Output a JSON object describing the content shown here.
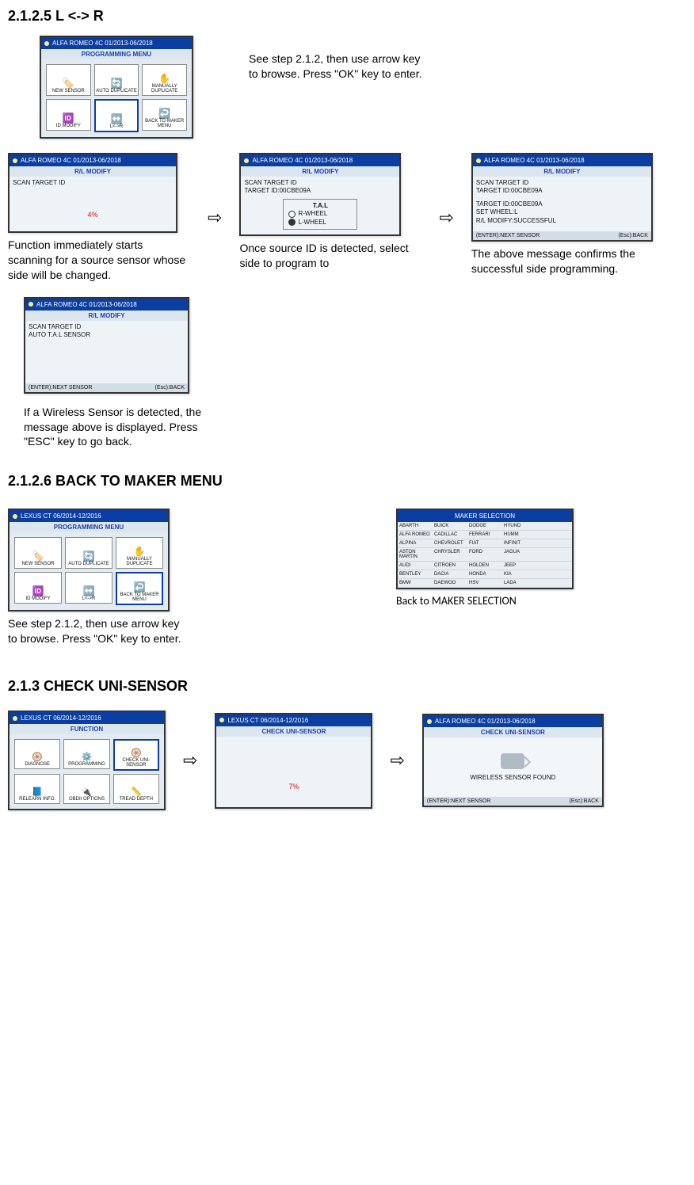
{
  "s2125": {
    "heading": "2.1.2.5 L <-> R",
    "topCaption": "See step 2.1.2, then use arrow key to browse. Press \"OK\" key to enter.",
    "progMenu": {
      "titlebar": "ALFA ROMEO  4C  01/2013-06/2018",
      "subtitle": "PROGRAMMING MENU",
      "items": [
        {
          "label": "NEW SENSOR"
        },
        {
          "label": "AUTO DUPLICATE"
        },
        {
          "label": "MANUALLY DUPLICATE"
        },
        {
          "label": "ID MODIFY"
        },
        {
          "label": "L<->R",
          "selected": true
        },
        {
          "label": "BACK TO MAKER MENU"
        }
      ]
    },
    "scanScreen": {
      "titlebar": "ALFA ROMEO  4C  01/2013-06/2018",
      "subtitle": "R/L MODIFY",
      "line1": "SCAN TARGET ID",
      "progress": "4%"
    },
    "scanCaption": "Function immediately starts scanning for a source sensor whose side will be changed.",
    "wheelScreen": {
      "titlebar": "ALFA ROMEO  4C  01/2013-06/2018",
      "subtitle": "R/L MODIFY",
      "line1": "SCAN TARGET ID",
      "line2": "TARGET ID:00CBE09A",
      "boxTitle": "T.A.L",
      "opt1": "R-WHEEL",
      "opt2": "L-WHEEL"
    },
    "wheelCaption": "Once source ID is detected, select side to program to",
    "successScreen": {
      "titlebar": "ALFA ROMEO  4C  01/2013-06/2018",
      "subtitle": "R/L MODIFY",
      "l1": "SCAN TARGET ID",
      "l2": "TARGET ID:00CBE09A",
      "l3": "TARGET ID:00CBE09A",
      "l4": "SET WHEEL:L",
      "l5": "R/L MODIFY:SUCCESSFUL",
      "footL": "(ENTER):NEXT SENSOR",
      "footR": "(Esc):BACK"
    },
    "successCaption": "The above message confirms the successful side programming.",
    "autoScreen": {
      "titlebar": "ALFA ROMEO  4C  01/2013-06/2018",
      "subtitle": "R/L MODIFY",
      "l1": "SCAN TARGET ID",
      "l2": "AUTO T.A.L SENSOR",
      "footL": "(ENTER):NEXT SENSOR",
      "footR": "(Esc):BACK"
    },
    "autoCaption": "If a Wireless Sensor is detected, the message above is displayed. Press \"ESC\" key to go back."
  },
  "s2126": {
    "heading": "2.1.2.6 BACK TO MAKER MENU",
    "progMenu": {
      "titlebar": "LEXUS  CT  06/2014-12/2016",
      "subtitle": "PROGRAMMING MENU",
      "items": [
        {
          "label": "NEW SENSOR"
        },
        {
          "label": "AUTO DUPLICATE"
        },
        {
          "label": "MANUALLY DUPLICATE"
        },
        {
          "label": "ID MODIFY"
        },
        {
          "label": "L<->R"
        },
        {
          "label": "BACK TO MAKER MENU",
          "selected": true
        }
      ]
    },
    "leftCaption": "See step 2.1.2, then use arrow key to browse. Press \"OK\" key to enter.",
    "makerScreen": {
      "title": "MAKER SELECTION",
      "rows": [
        [
          "ABARTH",
          "BUICK",
          "DODGE",
          "HYUND",
          ""
        ],
        [
          "ALFA ROMEO",
          "CADILLAC",
          "FERRARI",
          "HUMM",
          ""
        ],
        [
          "ALPINA",
          "CHEVROLET",
          "FIAT",
          "INFINIT",
          ""
        ],
        [
          "ASTON MARTIN",
          "CHRYSLER",
          "FORD",
          "JAGUA",
          ""
        ],
        [
          "AUDI",
          "CITROEN",
          "HOLDEN",
          "JEEP",
          ""
        ],
        [
          "BENTLEY",
          "DACIA",
          "HONDA",
          "KIA",
          ""
        ],
        [
          "BMW",
          "DAEWOO",
          "HSV",
          "LADA",
          ""
        ]
      ]
    },
    "rightCaption": "Back to MAKER SELECTION"
  },
  "s213": {
    "heading": "2.1.3 CHECK UNI-SENSOR",
    "funcScreen": {
      "titlebar": "LEXUS  CT  06/2014-12/2016",
      "subtitle": "FUNCTION",
      "items": [
        {
          "label": "DIAGNOSE"
        },
        {
          "label": "PROGRAMMING"
        },
        {
          "label": "CHECK UNI-SENSOR",
          "selected": true
        },
        {
          "label": "RELEARN INFO."
        },
        {
          "label": "OBDII OPTIONS"
        },
        {
          "label": "TREAD DEPTH"
        }
      ]
    },
    "checkScreen": {
      "titlebar": "LEXUS  CT  06/2014-12/2016",
      "subtitle": "CHECK UNI-SENSOR",
      "progress": "7%"
    },
    "foundScreen": {
      "titlebar": "ALFA ROMEO  4C  01/2013-06/2018",
      "subtitle": "CHECK UNI-SENSOR",
      "msg": "WIRELESS SENSOR FOUND",
      "footL": "(ENTER):NEXT SENSOR",
      "footR": "(Esc):BACK"
    }
  }
}
